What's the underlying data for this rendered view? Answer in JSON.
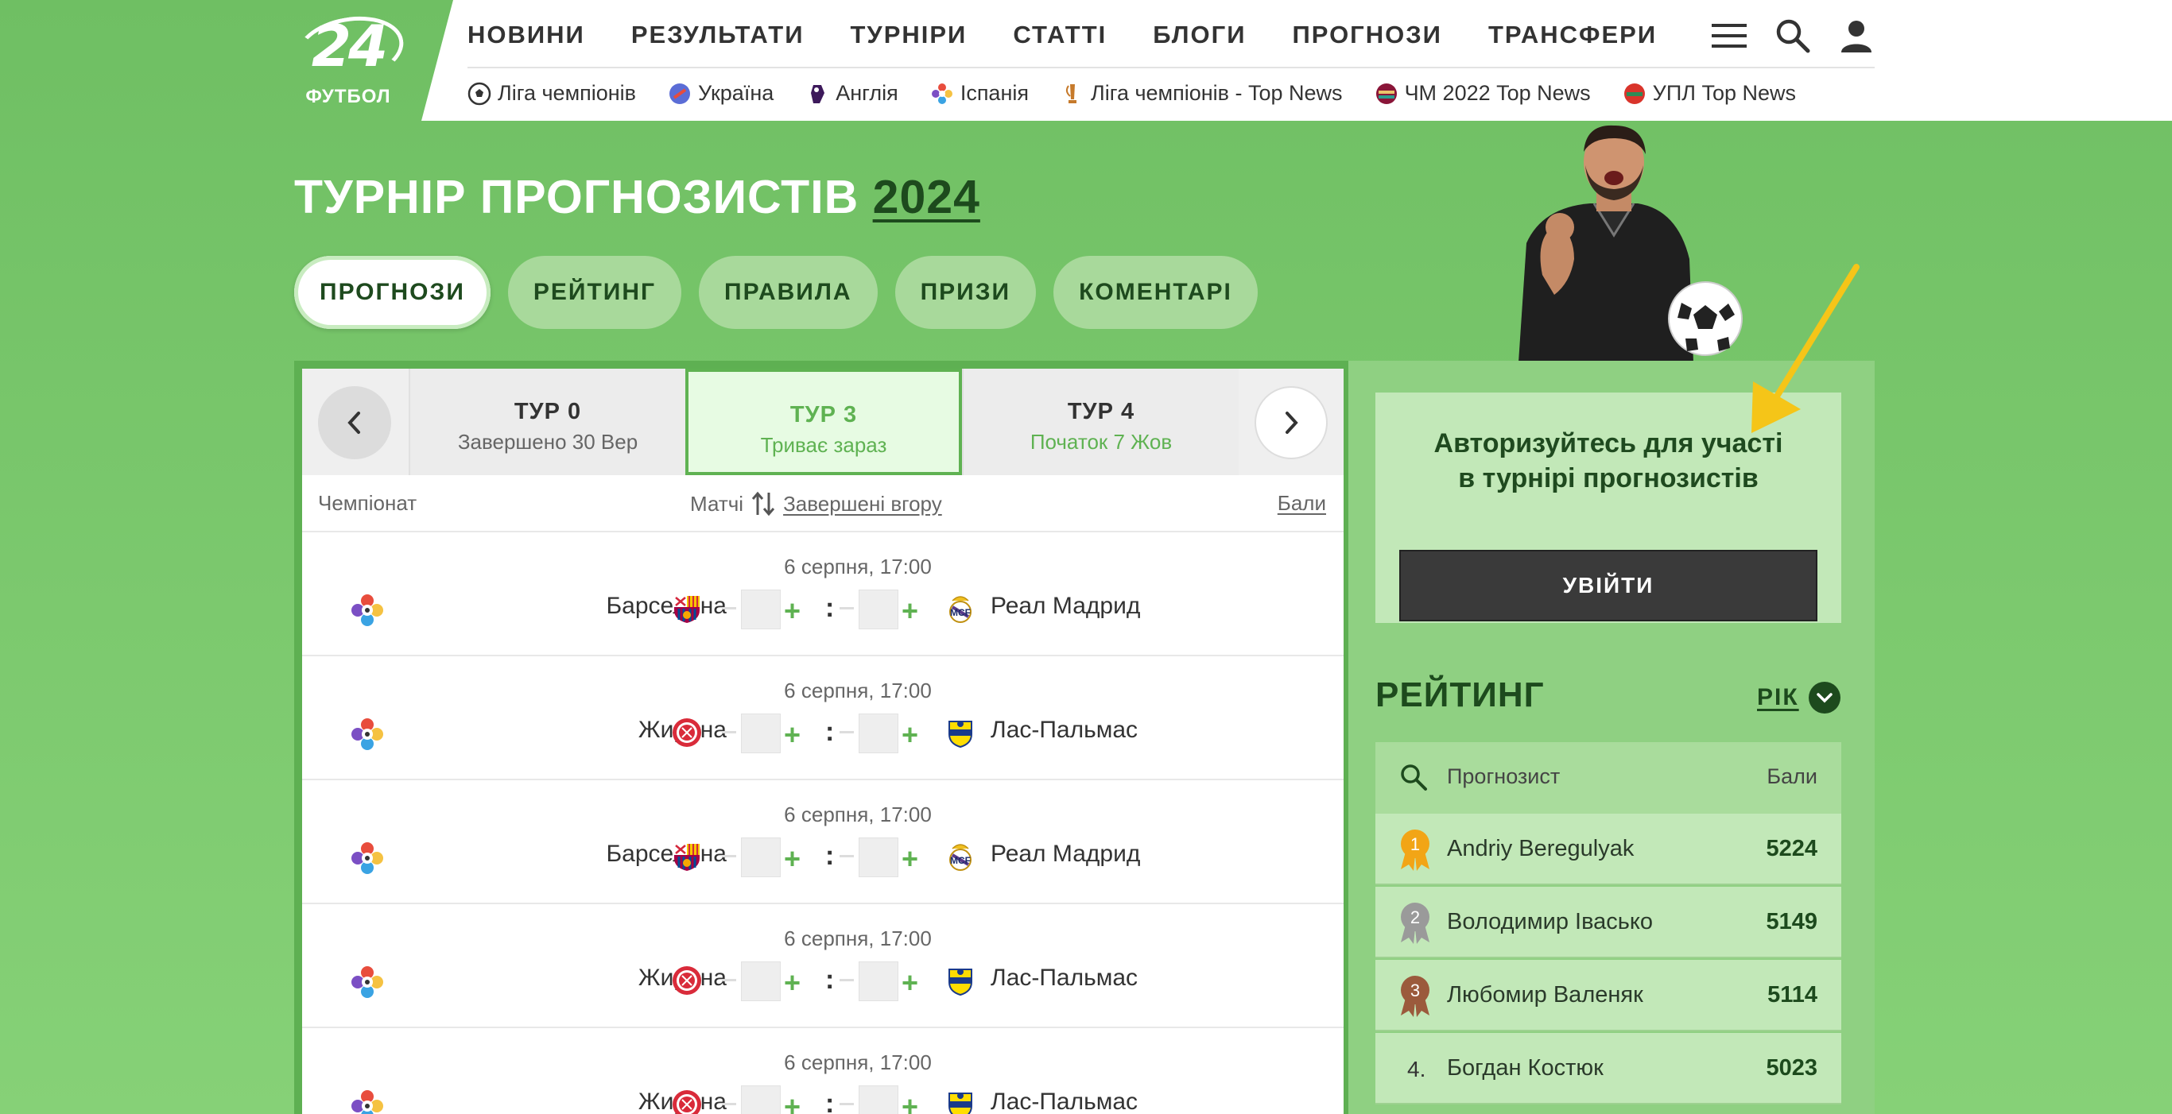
{
  "logo": {
    "number": "24",
    "text": "ФУТБОЛ"
  },
  "main_nav": [
    "НОВИНИ",
    "РЕЗУЛЬТАТИ",
    "ТУРНІРИ",
    "СТАТТІ",
    "БЛОГИ",
    "ПРОГНОЗИ",
    "ТРАНСФЕРИ"
  ],
  "sub_nav": [
    {
      "label": "Ліга чемпіонів",
      "icon": "ball-icon",
      "color": "#333333"
    },
    {
      "label": "Україна",
      "icon": "ukraine-league-icon",
      "color": "#5b6dd6"
    },
    {
      "label": "Англія",
      "icon": "premier-league-icon",
      "color": "#3d195b"
    },
    {
      "label": "Іспанія",
      "icon": "laliga-icon",
      "color": "#e84d3d"
    },
    {
      "label": "Ліга чемпіонів - Top News",
      "icon": "europa-trophy-icon",
      "color": "#c67a2b"
    },
    {
      "label": "ЧМ 2022 Top News",
      "icon": "world-cup-icon",
      "color": "#8a1538"
    },
    {
      "label": "УПЛ Top News",
      "icon": "upl-icon",
      "color": "#d9342b"
    }
  ],
  "page": {
    "title": "ТУРНІР ПРОГНОЗИСТІВ",
    "year": "2024"
  },
  "tabs": [
    {
      "label": "ПРОГНОЗИ",
      "active": true
    },
    {
      "label": "РЕЙТИНГ",
      "active": false
    },
    {
      "label": "ПРАВИЛА",
      "active": false
    },
    {
      "label": "ПРИЗИ",
      "active": false
    },
    {
      "label": "КОМЕНТАРІ",
      "active": false
    }
  ],
  "tours": [
    {
      "name": "ТУР 0",
      "status": "Завершено 30 Вер",
      "state": "finished"
    },
    {
      "name": "ТУР 3",
      "status": "Триває зараз",
      "state": "active"
    },
    {
      "name": "ТУР 4",
      "status": "Початок 7 Жов",
      "state": "upcoming"
    }
  ],
  "list_head": {
    "championship": "Чемпіонат",
    "matches": "Матчі",
    "sort": "Завершені вгору",
    "points": "Бали"
  },
  "matches": [
    {
      "time": "6 серпня, 17:00",
      "home": "Барселона",
      "home_logo": "barcelona-crest-icon",
      "away": "Реал Мадрид",
      "away_logo": "real-madrid-crest-icon"
    },
    {
      "time": "6 серпня, 17:00",
      "home": "Жирона",
      "home_logo": "girona-crest-icon",
      "away": "Лас-Пальмас",
      "away_logo": "las-palmas-crest-icon"
    },
    {
      "time": "6 серпня, 17:00",
      "home": "Барселона",
      "home_logo": "barcelona-crest-icon",
      "away": "Реал Мадрид",
      "away_logo": "real-madrid-crest-icon"
    },
    {
      "time": "6 серпня, 17:00",
      "home": "Жирона",
      "home_logo": "girona-crest-icon",
      "away": "Лас-Пальмас",
      "away_logo": "las-palmas-crest-icon"
    },
    {
      "time": "6 серпня, 17:00",
      "home": "Жирона",
      "home_logo": "girona-crest-icon",
      "away": "Лас-Пальмас",
      "away_logo": "las-palmas-crest-icon"
    }
  ],
  "score_separator": ":",
  "auth": {
    "text_line1": "Авторизуйтесь для участі",
    "text_line2": "в турнірі прогнозистів",
    "button": "УВІЙТИ"
  },
  "rating": {
    "title": "РЕЙТИНГ",
    "period": "РІК",
    "head_label": "Прогнозист",
    "head_points": "Бали",
    "rows": [
      {
        "rank": "1",
        "name": "Andriy Beregulyak",
        "points": "5224",
        "medal": "gold"
      },
      {
        "rank": "2",
        "name": "Володимир Івасько",
        "points": "5149",
        "medal": "silver"
      },
      {
        "rank": "3",
        "name": "Любомир Валеняк",
        "points": "5114",
        "medal": "bronze"
      },
      {
        "rank": "4.",
        "name": "Богдан Костюк",
        "points": "5023",
        "medal": "none"
      }
    ]
  },
  "colors": {
    "accent": "#5fb252",
    "dark_green": "#1d4a1d",
    "gold": "#f2a516",
    "silver": "#9a9a9a",
    "bronze": "#9b5a3c"
  }
}
